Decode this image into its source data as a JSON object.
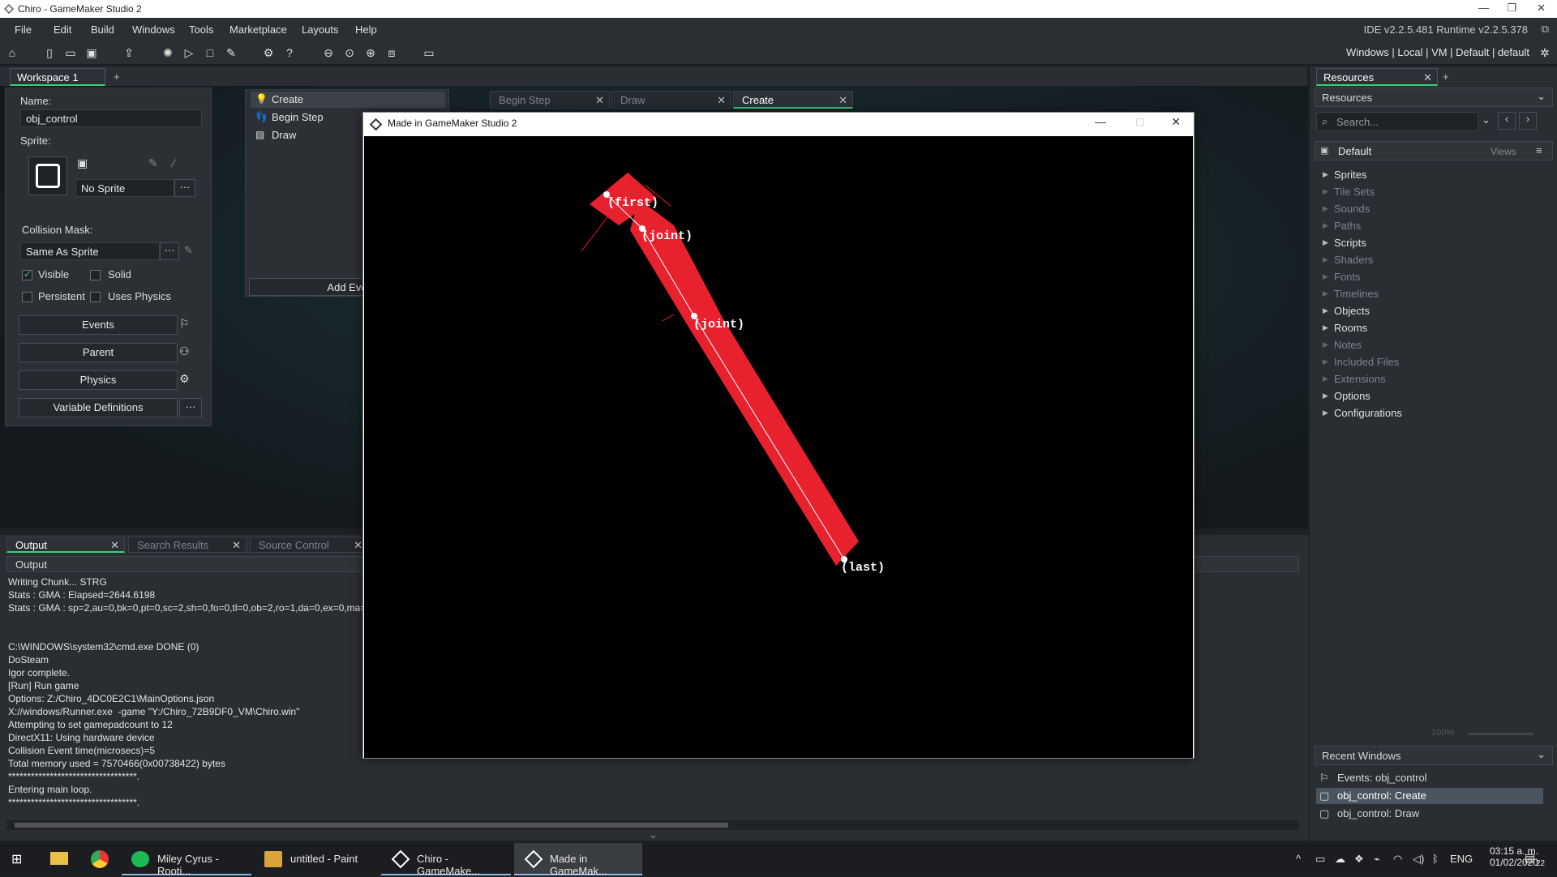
{
  "window": {
    "title": "Chiro - GameMaker Studio 2"
  },
  "menu": [
    "File",
    "Edit",
    "Build",
    "Windows",
    "Tools",
    "Marketplace",
    "Layouts",
    "Help"
  ],
  "ide_version": "IDE v2.2.5.481  Runtime v2.2.5.378",
  "target_bar": "Windows  |  Local  |  VM  |  Default  |  default",
  "workspace_tab": "Workspace 1",
  "object": {
    "name_label": "Name:",
    "name_value": "obj_control",
    "sprite_label": "Sprite:",
    "sprite_value": "No Sprite",
    "collision_label": "Collision Mask:",
    "collision_value": "Same As Sprite",
    "visible": "Visible",
    "solid": "Solid",
    "persistent": "Persistent",
    "uses_physics": "Uses Physics",
    "events_btn": "Events",
    "parent_btn": "Parent",
    "physics_btn": "Physics",
    "vardefs_btn": "Variable Definitions",
    "more": "···"
  },
  "events": [
    "Create",
    "Begin Step",
    "Draw"
  ],
  "add_event": "Add Eve",
  "code_tabs": [
    "Begin Step",
    "Draw",
    "Create"
  ],
  "game_window": {
    "title": "Made in GameMaker Studio 2",
    "labels": [
      "(first)",
      "(joint)",
      "(joint)",
      "(last)"
    ]
  },
  "resources": {
    "tab": "Resources",
    "header": "Resources",
    "search_placeholder": "Search...",
    "group": "Default",
    "views": "Views",
    "items": [
      {
        "label": "Sprites",
        "active": true
      },
      {
        "label": "Tile Sets",
        "active": false
      },
      {
        "label": "Sounds",
        "active": false
      },
      {
        "label": "Paths",
        "active": false
      },
      {
        "label": "Scripts",
        "active": true
      },
      {
        "label": "Shaders",
        "active": false
      },
      {
        "label": "Fonts",
        "active": false
      },
      {
        "label": "Timelines",
        "active": false
      },
      {
        "label": "Objects",
        "active": true
      },
      {
        "label": "Rooms",
        "active": true
      },
      {
        "label": "Notes",
        "active": false
      },
      {
        "label": "Included Files",
        "active": false
      },
      {
        "label": "Extensions",
        "active": false
      },
      {
        "label": "Options",
        "active": true
      },
      {
        "label": "Configurations",
        "active": true
      }
    ],
    "zoom": "100%",
    "recent_header": "Recent Windows",
    "recent": [
      "Events: obj_control",
      "obj_control: Create",
      "obj_control: Draw"
    ]
  },
  "output": {
    "tabs": [
      "Output",
      "Search Results",
      "Source Control"
    ],
    "header": "Output",
    "text": "Writing Chunk... STRG\nStats : GMA : Elapsed=2644.6198\nStats : GMA : sp=2,au=0,bk=0,pt=0,sc=2,sh=0,fo=0,tl=0,ob=2,ro=1,da=0,ex=0,ma=\n\n\nC:\\WINDOWS\\system32\\cmd.exe DONE (0)\nDoSteam\nIgor complete.\n[Run] Run game\nOptions: Z:/Chiro_4DC0E2C1\\MainOptions.json\nX://windows/Runner.exe  -game \"Y:/Chiro_72B9DF0_VM\\Chiro.win\"\nAttempting to set gamepadcount to 12\nDirectX11: Using hardware device\nCollision Event time(microsecs)=5\nTotal memory used = 7570466(0x00738422) bytes\n**********************************.\nEntering main loop.\n**********************************."
  },
  "taskbar": {
    "items": [
      "Miley Cyrus - Rooti...",
      "untitled - Paint",
      "Chiro - GameMake...",
      "Made in GameMak..."
    ],
    "lang": "ENG",
    "time": "03:15 a. m.",
    "date": "01/02/2020",
    "notif": "22"
  }
}
